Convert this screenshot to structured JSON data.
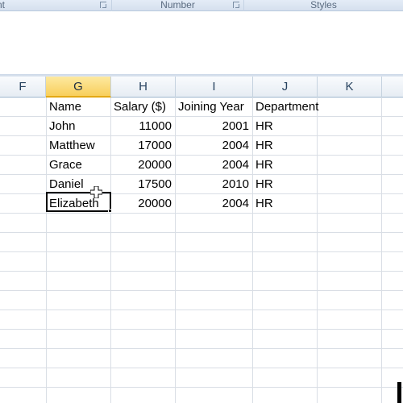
{
  "ribbon": {
    "groups": [
      {
        "label": "nt",
        "has_launcher": true
      },
      {
        "label": "Number",
        "has_launcher": true
      },
      {
        "label": "Styles",
        "has_launcher": false
      }
    ]
  },
  "columns": [
    {
      "letter": "F",
      "active": false
    },
    {
      "letter": "G",
      "active": true
    },
    {
      "letter": "H",
      "active": false
    },
    {
      "letter": "I",
      "active": false
    },
    {
      "letter": "J",
      "active": false
    },
    {
      "letter": "K",
      "active": false
    }
  ],
  "table": {
    "headers": [
      "Name",
      "Salary ($)",
      "Joining Year",
      "Department"
    ],
    "rows": [
      [
        "John",
        "11000",
        "2001",
        "HR"
      ],
      [
        "Matthew",
        "17000",
        "2004",
        "HR"
      ],
      [
        "Grace",
        "20000",
        "2004",
        "HR"
      ],
      [
        "Daniel",
        "17500",
        "2010",
        "HR"
      ],
      [
        "Elizabeth",
        "20000",
        "2004",
        "HR"
      ]
    ]
  },
  "selection": {
    "cell": "G11",
    "value": ""
  },
  "icons": {
    "cursor": "plus-cell-cursor-icon",
    "launcher": "dialog-launcher-icon"
  }
}
